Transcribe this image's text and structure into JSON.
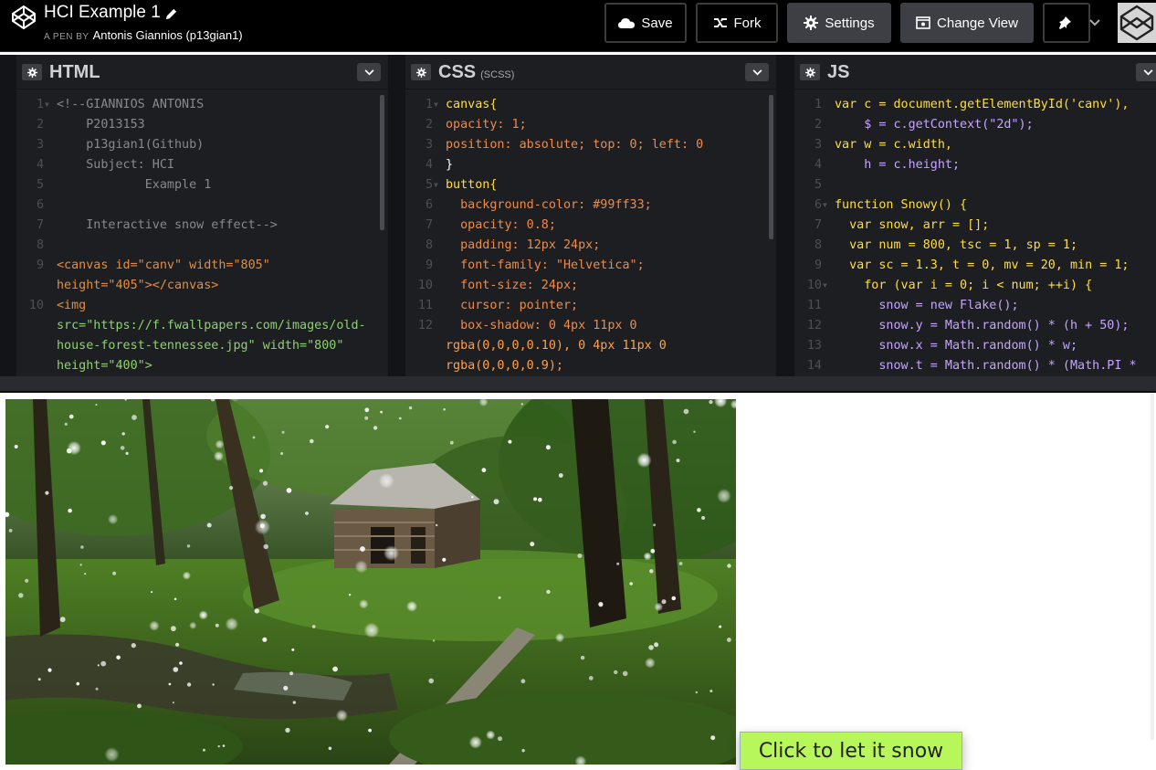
{
  "header": {
    "title": "HCI Example 1",
    "by_prefix": "A PEN BY",
    "author": "Antonis Giannios (p13gian1)",
    "buttons": {
      "save": "Save",
      "fork": "Fork",
      "settings": "Settings",
      "change_view": "Change View"
    },
    "icons": [
      "codepen-logo-icon",
      "pencil-icon",
      "cloud-icon",
      "fork-icon",
      "gear-icon",
      "change-view-icon",
      "pin-icon",
      "chevron-down-icon",
      "avatar"
    ]
  },
  "panes": {
    "html": {
      "title": "HTML",
      "line_numbers": [
        "1",
        "2",
        "3",
        "4",
        "5",
        "6",
        "7",
        "8",
        "9",
        "",
        "10",
        "",
        ""
      ],
      "lines": [
        "<!--GIANNIOS ANTONIS",
        "    P2013153",
        "    p13gian1(Github)",
        "    Subject: HCI",
        "            Example 1",
        "",
        "    Interactive snow effect-->",
        "",
        "<canvas id=\"canv\" width=\"805\"",
        "height=\"405\"></canvas>",
        "<img",
        "src=\"https://f.fwallpapers.com/images/old-",
        "house-forest-tennessee.jpg\" width=\"800\"",
        "height=\"400\">"
      ]
    },
    "css": {
      "title": "CSS",
      "subtitle": "(SCSS)",
      "line_numbers": [
        "1",
        "2",
        "3",
        "4",
        "5",
        "6",
        "7",
        "8",
        "9",
        "10",
        "11",
        "12",
        "",
        ""
      ],
      "lines": [
        "canvas{",
        "opacity: 1;",
        "position: absolute; top: 0; left: 0",
        "}",
        "button{",
        "  background-color: #99ff33;",
        "  opacity: 0.8;",
        "  padding: 12px 24px;",
        "  font-family: \"Helvetica\";",
        "  font-size: 24px;",
        "  cursor: pointer;",
        "  box-shadow: 0 4px 11px 0",
        "rgba(0,0,0,0.10), 0 4px 11px 0",
        "rgba(0,0,0,0.9);"
      ]
    },
    "js": {
      "title": "JS",
      "line_numbers": [
        "1",
        "2",
        "3",
        "4",
        "5",
        "6",
        "7",
        "8",
        "9",
        "10",
        "11",
        "12",
        "13",
        "14"
      ],
      "lines": [
        "var c = document.getElementById('canv'),",
        "    $ = c.getContext(\"2d\");",
        "var w = c.width,",
        "    h = c.height;",
        "",
        "function Snowy() {",
        "  var snow, arr = [];",
        "  var num = 800, tsc = 1, sp = 1;",
        "  var sc = 1.3, t = 0, mv = 20, min = 1;",
        "    for (var i = 0; i < num; ++i) {",
        "      snow = new Flake();",
        "      snow.y = Math.random() * (h + 50);",
        "      snow.x = Math.random() * w;",
        "      snow.t = Math.random() * (Math.PI *"
      ]
    }
  },
  "preview": {
    "image_alt": "old house forest tennessee",
    "button_label": "Click to let it snow",
    "button_color": "#b8f75a"
  }
}
